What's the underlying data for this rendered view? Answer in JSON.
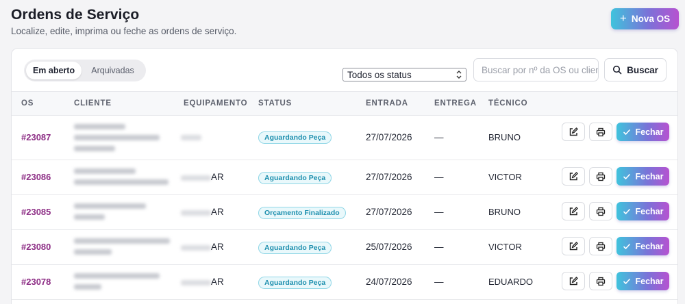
{
  "header": {
    "title": "Ordens de Serviço",
    "subtitle": "Localize, edite, imprima ou feche as ordens de serviço.",
    "new_button": "Nova OS"
  },
  "toolbar": {
    "tabs": [
      {
        "label": "Em aberto",
        "active": true
      },
      {
        "label": "Arquivadas",
        "active": false
      }
    ],
    "status_select": "Todos os status",
    "search_placeholder": "Buscar por nº da OS ou cliente",
    "search_button": "Buscar"
  },
  "table": {
    "columns": [
      "OS",
      "CLIENTE",
      "EQUIPAMENTO",
      "STATUS",
      "ENTRADA",
      "ENTREGA",
      "TÉCNICO"
    ],
    "rows": [
      {
        "os": "#23087",
        "equipamento": "",
        "status": "Aguardando Peça",
        "entrada": "27/07/2026",
        "entrega": "—",
        "tecnico": "BRUNO"
      },
      {
        "os": "#23086",
        "equipamento": "AR",
        "status": "Aguardando Peça",
        "entrada": "27/07/2026",
        "entrega": "—",
        "tecnico": "VICTOR"
      },
      {
        "os": "#23085",
        "equipamento": "AR",
        "status": "Orçamento Finalizado",
        "entrada": "27/07/2026",
        "entrega": "—",
        "tecnico": "BRUNO"
      },
      {
        "os": "#23080",
        "equipamento": "AR",
        "status": "Aguardando Peça",
        "entrada": "25/07/2026",
        "entrega": "—",
        "tecnico": "VICTOR"
      },
      {
        "os": "#23078",
        "equipamento": "AR",
        "status": "Aguardando Peça",
        "entrada": "24/07/2026",
        "entrega": "—",
        "tecnico": "EDUARDO"
      }
    ],
    "close_label": "Fechar"
  },
  "colors": {
    "os_link": "#8e2f86",
    "badge_text": "#1d8fae",
    "gradient_start": "#3fc3dc",
    "gradient_end": "#b652d0"
  }
}
